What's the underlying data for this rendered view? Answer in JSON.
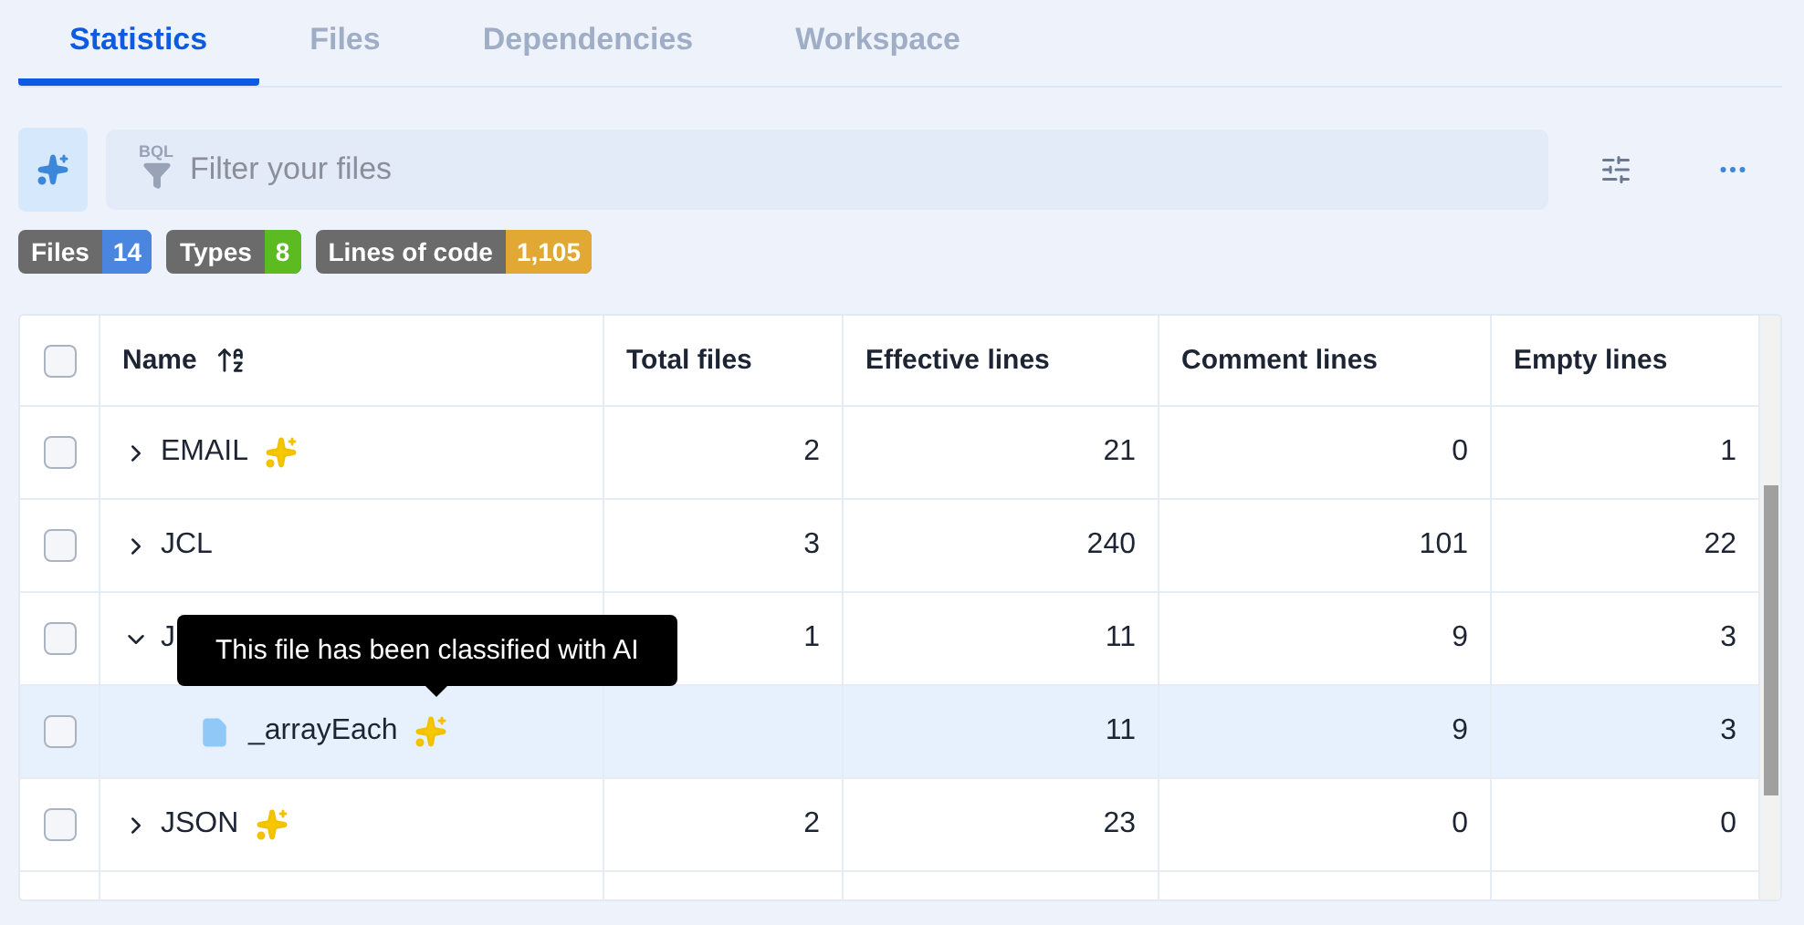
{
  "tabs": [
    {
      "label": "Statistics",
      "selected": true
    },
    {
      "label": "Files",
      "selected": false
    },
    {
      "label": "Dependencies",
      "selected": false
    },
    {
      "label": "Workspace",
      "selected": false
    }
  ],
  "filter": {
    "prefix": "BQL",
    "placeholder": "Filter your files"
  },
  "badges": [
    {
      "label": "Files",
      "count": "14",
      "color": "#4a86e0"
    },
    {
      "label": "Types",
      "count": "8",
      "color": "#5bbb20"
    },
    {
      "label": "Lines of code",
      "count": "1,105",
      "color": "#e2a834"
    }
  ],
  "table": {
    "all_checked": false,
    "columns": [
      "Name",
      "Total files",
      "Effective lines",
      "Comment lines",
      "Empty lines"
    ],
    "rows": [
      {
        "name": "EMAIL",
        "checked": false,
        "expanded": false,
        "ai": true,
        "highlighted": false,
        "cells": [
          "2",
          "21",
          "0",
          "1"
        ]
      },
      {
        "name": "JCL",
        "checked": false,
        "expanded": false,
        "ai": false,
        "highlighted": false,
        "cells": [
          "3",
          "240",
          "101",
          "22"
        ]
      },
      {
        "name": "J",
        "checked": false,
        "expanded": true,
        "ai": false,
        "highlighted": false,
        "cells": [
          "1",
          "11",
          "9",
          "3"
        ],
        "children": [
          {
            "name": "_arrayEach",
            "checked": false,
            "ai": true,
            "highlighted": true,
            "cells": [
              "11",
              "9",
              "3"
            ]
          }
        ]
      },
      {
        "name": "JSON",
        "checked": false,
        "expanded": false,
        "ai": true,
        "highlighted": false,
        "cells": [
          "2",
          "23",
          "0",
          "0"
        ]
      }
    ]
  },
  "tooltip": {
    "text": "This file has been classified with AI"
  }
}
